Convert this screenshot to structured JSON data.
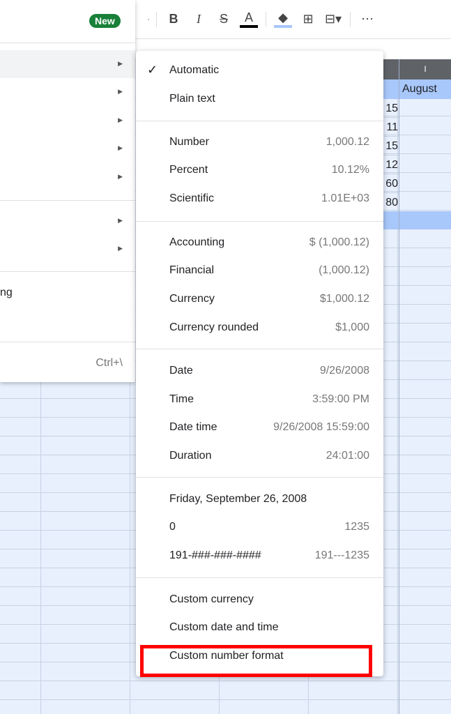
{
  "toolbar": {
    "new_badge": "New",
    "icons": [
      "bold-icon",
      "italic-icon",
      "strikethrough-icon",
      "text-color-icon",
      "fill-color-icon",
      "borders-icon",
      "merge-cells-icon",
      "more-icon"
    ],
    "bold": "B",
    "italic": "I",
    "strike": "S",
    "textcolor": "A",
    "more": "⋯"
  },
  "colors": {
    "accent": "#188038",
    "highlight": "#ff0000",
    "selection": "#a8c7fa"
  },
  "sheet": {
    "column_letter": "I",
    "header": "August",
    "values": [
      "15",
      "11",
      "15",
      "12",
      "60",
      "80"
    ]
  },
  "left_menu": {
    "partial_label": "ng",
    "shortcut": "Ctrl+\\"
  },
  "submenu": {
    "automatic": "Automatic",
    "plain_text": "Plain text",
    "items": [
      {
        "label": "Number",
        "value": "1,000.12"
      },
      {
        "label": "Percent",
        "value": "10.12%"
      },
      {
        "label": "Scientific",
        "value": "1.01E+03"
      },
      {
        "label": "Accounting",
        "value": "$ (1,000.12)"
      },
      {
        "label": "Financial",
        "value": "(1,000.12)"
      },
      {
        "label": "Currency",
        "value": "$1,000.12"
      },
      {
        "label": "Currency rounded",
        "value": "$1,000"
      },
      {
        "label": "Date",
        "value": "9/26/2008"
      },
      {
        "label": "Time",
        "value": "3:59:00 PM"
      },
      {
        "label": "Date time",
        "value": "9/26/2008 15:59:00"
      },
      {
        "label": "Duration",
        "value": "24:01:00"
      },
      {
        "label": "Friday, September 26, 2008",
        "value": ""
      },
      {
        "label": "0",
        "value": "1235"
      },
      {
        "label": "191-###-###-####",
        "value": "191---1235"
      }
    ],
    "custom_currency": "Custom currency",
    "custom_date_time": "Custom date and time",
    "custom_number_format": "Custom number format"
  }
}
